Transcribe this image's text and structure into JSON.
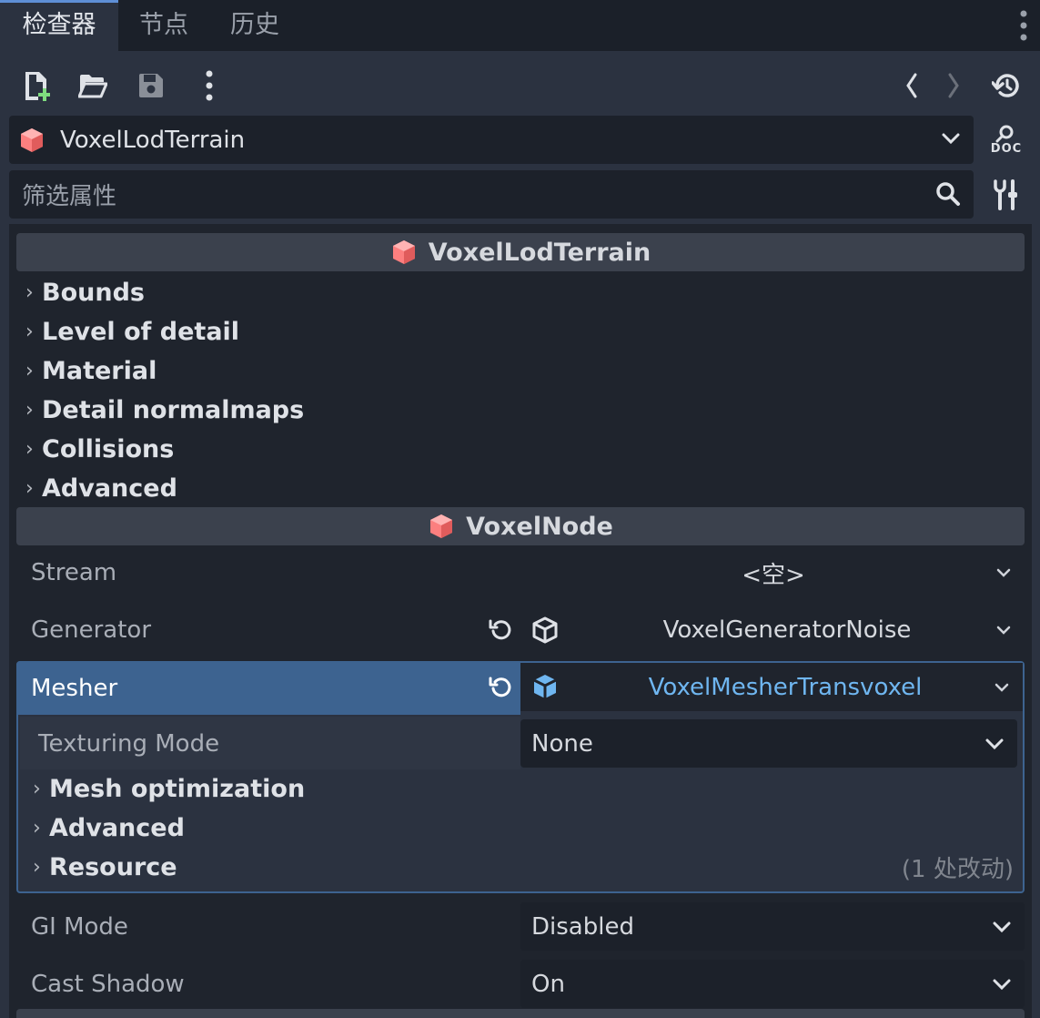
{
  "tabs": [
    {
      "label": "检查器",
      "active": true
    },
    {
      "label": "节点",
      "active": false
    },
    {
      "label": "历史",
      "active": false
    }
  ],
  "toolbar": {
    "icons": [
      "new-resource-icon",
      "open-folder-icon",
      "save-icon",
      "more-icon",
      "history-back-icon",
      "history-forward-icon",
      "object-history-icon"
    ]
  },
  "object_selector": {
    "value": "VoxelLodTerrain",
    "doc_label": "DOC"
  },
  "filter": {
    "placeholder": "筛选属性"
  },
  "sections": {
    "lod_terrain": {
      "title": "VoxelLodTerrain",
      "groups": [
        "Bounds",
        "Level of detail",
        "Material",
        "Detail normalmaps",
        "Collisions",
        "Advanced"
      ]
    },
    "voxel_node": {
      "title": "VoxelNode"
    }
  },
  "properties": {
    "stream": {
      "label": "Stream",
      "value": "<空>"
    },
    "generator": {
      "label": "Generator",
      "value": "VoxelGeneratorNoise"
    },
    "mesher": {
      "label": "Mesher",
      "value": "VoxelMesherTransvoxel"
    },
    "texturing_mode": {
      "label": "Texturing Mode",
      "value": "None"
    },
    "mesher_groups": [
      "Mesh optimization",
      "Advanced",
      "Resource"
    ],
    "resource_changes": "(1 处改动)",
    "gi_mode": {
      "label": "GI Mode",
      "value": "Disabled"
    },
    "cast_shadow": {
      "label": "Cast Shadow",
      "value": "On"
    }
  },
  "colors": {
    "accent": "#5e8fd6",
    "selected_row": "#3d6390",
    "resource_link": "#6fb6f0",
    "node_icon": "#fc7f7f"
  }
}
